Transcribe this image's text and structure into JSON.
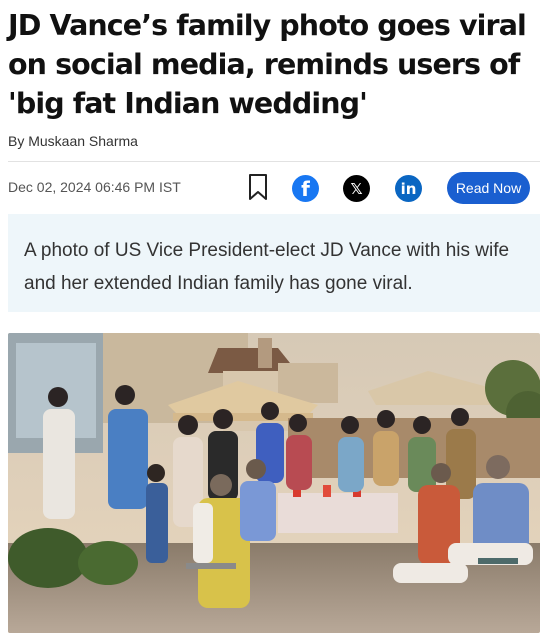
{
  "article": {
    "headline": "JD Vance’s family photo goes viral on social media, reminds users of 'big fat Indian wedding'",
    "byline": "By Muskaan Sharma",
    "date": "Dec 02, 2024 06:46 PM IST",
    "summary": "A photo of US Vice President-elect JD Vance with his wife and her extended Indian family has gone viral."
  },
  "actions": {
    "bookmark_icon": "bookmark-icon",
    "facebook_icon": "facebook-icon",
    "x_icon": "x-icon",
    "linkedin_icon": "linkedin-icon",
    "facebook_glyph": "f",
    "x_glyph": "𝕏",
    "linkedin_glyph": "in",
    "read_now_label": "Read Now"
  },
  "colors": {
    "facebook": "#1877f2",
    "x": "#000000",
    "linkedin": "#0a66c2",
    "read_now": "#1a5fd0",
    "summary_bg": "#eef6fa"
  }
}
